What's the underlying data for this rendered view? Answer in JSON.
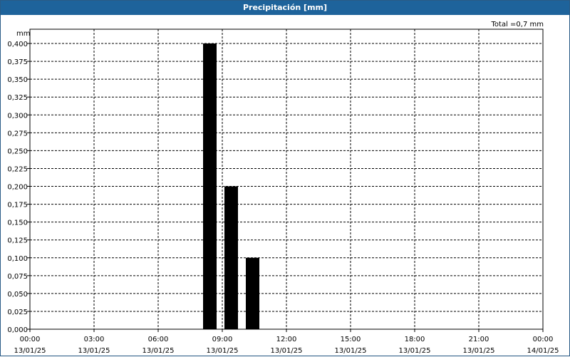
{
  "window": {
    "title": "Precipitación [mm]"
  },
  "chart_data": {
    "type": "bar",
    "title": "Precipitación [mm]",
    "ylabel": "mm",
    "total_label": "Total =0,7 mm",
    "ylim": [
      0,
      0.4
    ],
    "y_ticks": [
      "0,000",
      "0,025",
      "0,050",
      "0,075",
      "0,100",
      "0,125",
      "0,150",
      "0,175",
      "0,200",
      "0,225",
      "0,250",
      "0,275",
      "0,300",
      "0,325",
      "0,350",
      "0,375",
      "0,400"
    ],
    "x_range_hours": [
      0,
      24
    ],
    "x_ticks": [
      {
        "time": "00:00",
        "date": "13/01/25"
      },
      {
        "time": "03:00",
        "date": "13/01/25"
      },
      {
        "time": "06:00",
        "date": "13/01/25"
      },
      {
        "time": "09:00",
        "date": "13/01/25"
      },
      {
        "time": "12:00",
        "date": "13/01/25"
      },
      {
        "time": "15:00",
        "date": "13/01/25"
      },
      {
        "time": "18:00",
        "date": "13/01/25"
      },
      {
        "time": "21:00",
        "date": "13/01/25"
      },
      {
        "time": "00:00",
        "date": "14/01/25"
      }
    ],
    "bars": [
      {
        "time": "08:00-09:00",
        "value": 0.4
      },
      {
        "time": "09:00-10:00",
        "value": 0.2
      },
      {
        "time": "10:00-11:00",
        "value": 0.1
      }
    ],
    "grid": true,
    "colors": {
      "bar": "#000000",
      "grid": "#000000",
      "title_bar": "#1e639b"
    }
  }
}
